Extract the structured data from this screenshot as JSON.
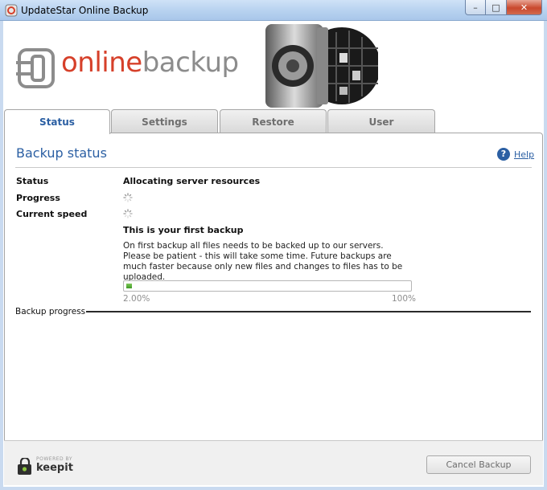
{
  "window": {
    "title": "UpdateStar Online Backup",
    "controls": {
      "minimize": "–",
      "maximize": "□",
      "close": "✕"
    }
  },
  "logo": {
    "online": "online",
    "backup": "backup"
  },
  "tabs": [
    {
      "label": "Status",
      "active": true
    },
    {
      "label": "Settings",
      "active": false
    },
    {
      "label": "Restore",
      "active": false
    },
    {
      "label": "User",
      "active": false
    }
  ],
  "main": {
    "section_title": "Backup status",
    "help_label": "Help",
    "status_label": "Status",
    "status_value": "Allocating server resources",
    "progress_label": "Progress",
    "speed_label": "Current speed",
    "first_backup_heading": "This is your first backup",
    "first_backup_text": "On first backup all files needs to be backed up to our servers. Please be patient - this will take some time. Future backups are much faster because only new files and changes to files has to be uploaded.",
    "progress": {
      "value": 0.02,
      "min_label": "2.00%",
      "max_label": "100%"
    },
    "backup_progress_label": "Backup progress"
  },
  "footer": {
    "powered_by": "POWERED BY",
    "brand": "keepit",
    "cancel_label": "Cancel Backup"
  },
  "colors": {
    "accent": "#2b5fa3",
    "logo_red": "#d6402a",
    "progress_green": "#4da62f"
  },
  "icons": [
    "app-icon",
    "minimize-icon",
    "maximize-icon",
    "close-icon",
    "help-icon",
    "spinner-icon",
    "keepit-logo-icon",
    "vault-door-icon",
    "plug-logo-icon"
  ]
}
